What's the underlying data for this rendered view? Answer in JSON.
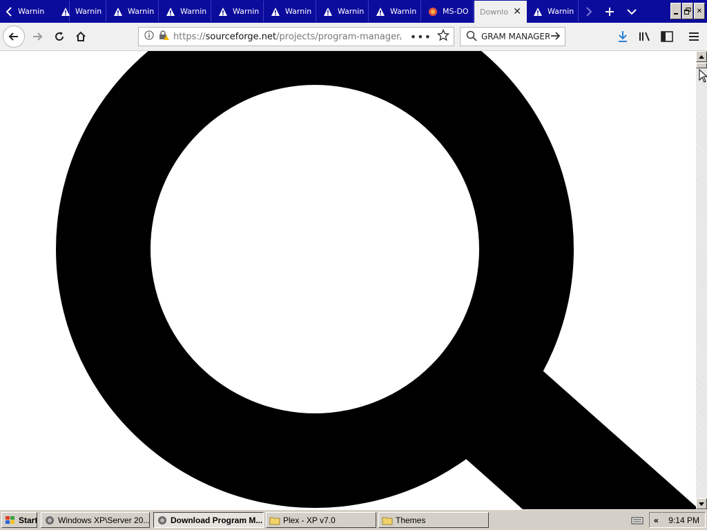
{
  "browser": {
    "tabs": [
      {
        "label": "Warnin",
        "icon": "warning-icon"
      },
      {
        "label": "Warnin",
        "icon": "warning-icon"
      },
      {
        "label": "Warnin",
        "icon": "warning-icon"
      },
      {
        "label": "Warnin",
        "icon": "warning-icon"
      },
      {
        "label": "Warnin",
        "icon": "warning-icon"
      },
      {
        "label": "Warnin",
        "icon": "warning-icon"
      },
      {
        "label": "Warnin",
        "icon": "warning-icon"
      },
      {
        "label": "Warnin",
        "icon": "warning-icon"
      },
      {
        "label": "MS-DO",
        "icon": "browser-logo-icon"
      },
      {
        "label": "Downlo",
        "icon": "",
        "active": true
      },
      {
        "label": "Warnin",
        "icon": "warning-icon"
      }
    ],
    "url": "https://sourceforge.net/projects/program-manager/file",
    "url_domain": "sourceforge.net",
    "url_path": "/projects/program-manager/file",
    "url_scheme": "https://",
    "search_text": "GRAM MANAGER",
    "colors": {
      "tabstrip": "#0c0c9c",
      "download_arrow": "#2a7fd4"
    }
  },
  "content": {
    "icon": "magnifier-icon"
  },
  "taskbar": {
    "start_label": "Start",
    "items": [
      {
        "label": "Windows XP\\Server 20...",
        "pressed": false
      },
      {
        "label": "Download Program M...",
        "pressed": true
      },
      {
        "label": "Plex - XP v7.0",
        "pressed": false
      },
      {
        "label": "Themes",
        "pressed": false
      }
    ],
    "tray_chevron": "«",
    "clock": "9:14 PM"
  }
}
